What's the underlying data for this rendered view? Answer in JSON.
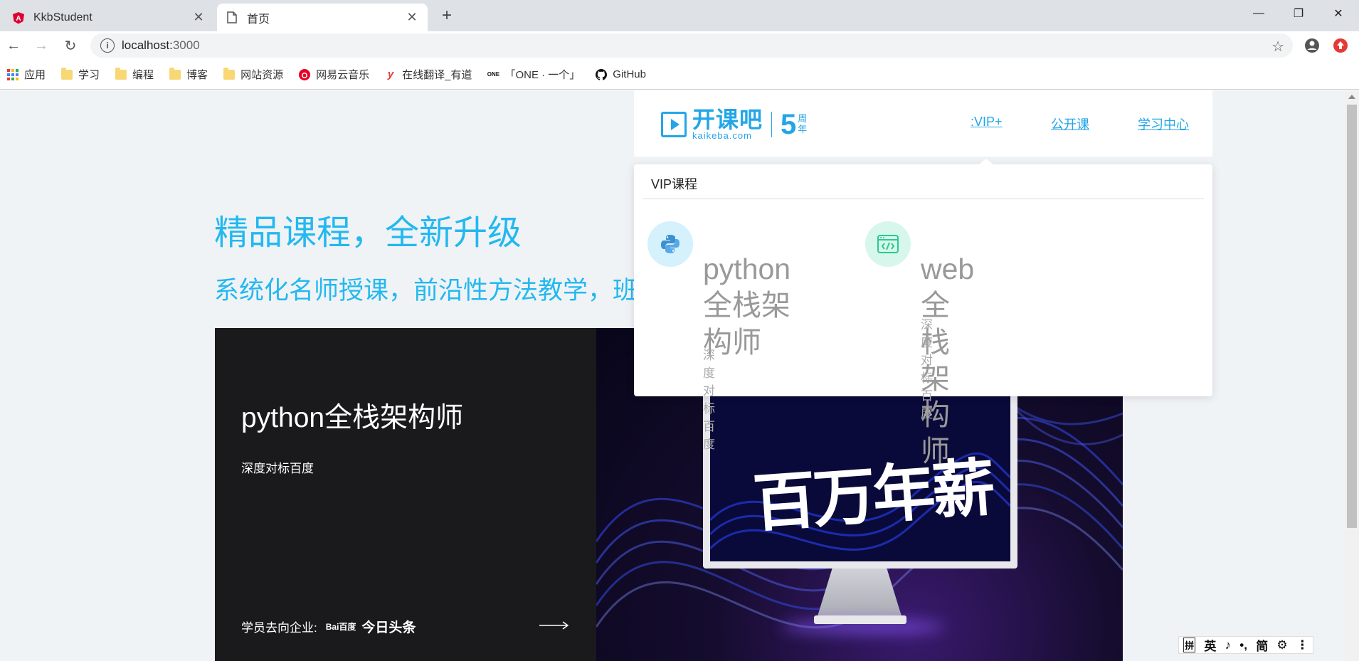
{
  "browser": {
    "tabs": [
      {
        "label": "KkbStudent",
        "active": false,
        "icon": "angular-icon"
      },
      {
        "label": "首页",
        "active": true,
        "icon": "page-icon"
      }
    ],
    "url_host": "localhost:",
    "url_port": "3000",
    "bookmarks": [
      {
        "label": "应用",
        "icon": "apps-icon"
      },
      {
        "label": "学习",
        "icon": "folder-icon"
      },
      {
        "label": "编程",
        "icon": "folder-icon"
      },
      {
        "label": "博客",
        "icon": "folder-icon"
      },
      {
        "label": "网站资源",
        "icon": "folder-icon"
      },
      {
        "label": "网易云音乐",
        "icon": "netease-music-icon"
      },
      {
        "label": "在线翻译_有道",
        "icon": "youdao-icon"
      },
      {
        "label": "「ONE · 一个」",
        "icon": "one-icon"
      },
      {
        "label": "GitHub",
        "icon": "github-icon"
      }
    ]
  },
  "hero": {
    "title": "精品课程，全新升级",
    "subtitle": "系统化名师授课，前沿性方法教学，班"
  },
  "card": {
    "title": "python全栈架构师",
    "desc": "深度对标百度",
    "foot_label": "学员去向企业:",
    "brand_baidu": "Bai百度",
    "brand_toutiao": "今日头条",
    "calligraphy": "百万年薪"
  },
  "header": {
    "logo_cn": "开课吧",
    "logo_en": "kaikeba.com",
    "logo_num": "5",
    "logo_anniv_1": "周",
    "logo_anniv_2": "年",
    "nav": [
      ":VIP+",
      "公开课",
      "学习中心"
    ]
  },
  "dropdown": {
    "heading": "VIP课程",
    "courses": [
      {
        "title_line1": "python全栈架",
        "title_line2": "构师",
        "desc": "深度对标百度",
        "icon": "python-icon"
      },
      {
        "title_line1": "web全栈架构师",
        "desc": "深度对标百度",
        "icon": "code-window-icon"
      }
    ]
  },
  "ime": [
    "拼",
    "英",
    "♪",
    "•,",
    "简",
    "⚙",
    "⋮"
  ],
  "colors": {
    "accent": "#23b8f0",
    "logo": "#23a6e8"
  }
}
